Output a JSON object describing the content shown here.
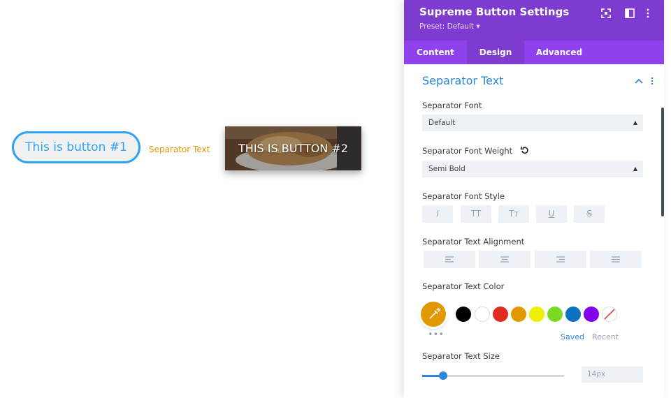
{
  "canvas": {
    "button1_label": "This is button #1",
    "separator_label": "Separator Text",
    "button2_label": "THIS IS BUTTON #2"
  },
  "panel": {
    "title": "Supreme Button Settings",
    "preset": "Preset: Default ▾",
    "icons": [
      "fullscreen-icon",
      "split-view-icon",
      "more-options-icon"
    ],
    "tabs": [
      {
        "label": "Content",
        "active": false
      },
      {
        "label": "Design",
        "active": true
      },
      {
        "label": "Advanced",
        "active": false
      }
    ]
  },
  "section": {
    "title": "Separator Text",
    "font_label": "Separator Font",
    "font_value": "Default",
    "weight_label": "Separator Font Weight",
    "weight_value": "Semi Bold",
    "style_label": "Separator Font Style",
    "style_buttons": [
      "I",
      "TT",
      "Tт",
      "U",
      "S"
    ],
    "alignment_label": "Separator Text Alignment",
    "alignments": [
      "align-left-icon",
      "align-center-icon",
      "align-right-icon",
      "align-justify-icon"
    ],
    "color_label": "Separator Text Color",
    "current_color": "#e09900",
    "swatches": [
      "#000000",
      "#ffffff",
      "#e02b20",
      "#e09900",
      "#edf000",
      "#7cda24",
      "#0c71c3",
      "#8300e9"
    ],
    "saved_label": "Saved",
    "recent_label": "Recent",
    "size_label": "Separator Text Size",
    "size_value": "14px",
    "size_slider_fraction": 0.15
  },
  "colors": {
    "header": "#7e3bd0",
    "tabs": "#8f42ec",
    "accent": "#2b87da"
  }
}
